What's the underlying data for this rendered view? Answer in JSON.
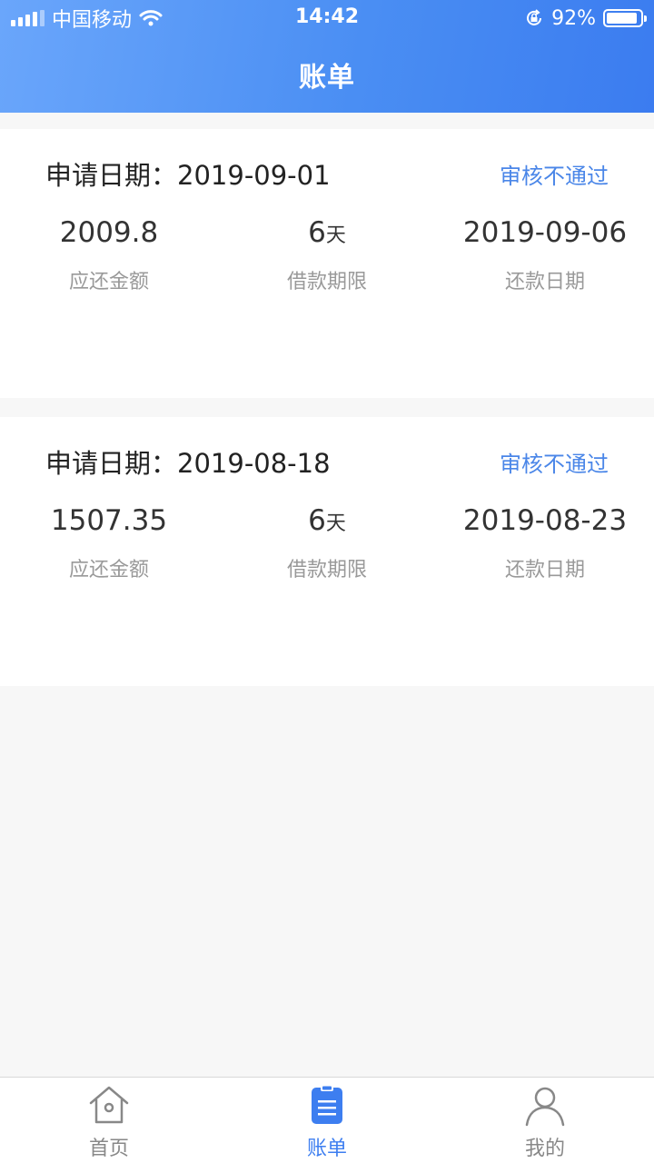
{
  "status_bar": {
    "carrier": "中国移动",
    "time": "14:42",
    "battery": "92%",
    "battery_level": 0.92
  },
  "header": {
    "title": "账单"
  },
  "bills": [
    {
      "apply_label": "申请日期：",
      "apply_date": "2019-09-01",
      "status": "审核不通过",
      "amount": "2009.8",
      "amount_label": "应还金额",
      "term": "6",
      "term_unit": "天",
      "term_label": "借款期限",
      "repay_date": "2019-09-06",
      "repay_label": "还款日期"
    },
    {
      "apply_label": "申请日期：",
      "apply_date": "2019-08-18",
      "status": "审核不通过",
      "amount": "1507.35",
      "amount_label": "应还金额",
      "term": "6",
      "term_unit": "天",
      "term_label": "借款期限",
      "repay_date": "2019-08-23",
      "repay_label": "还款日期"
    }
  ],
  "tabbar": {
    "home": {
      "label": "首页",
      "icon": "home-icon"
    },
    "bill": {
      "label": "账单",
      "icon": "clipboard-icon",
      "active": true
    },
    "me": {
      "label": "我的",
      "icon": "user-icon"
    }
  },
  "colors": {
    "header_start": "#6aa6fb",
    "header_end": "#3b7cf0",
    "accent": "#3d7ef0",
    "status_text": "#4a86e8"
  }
}
